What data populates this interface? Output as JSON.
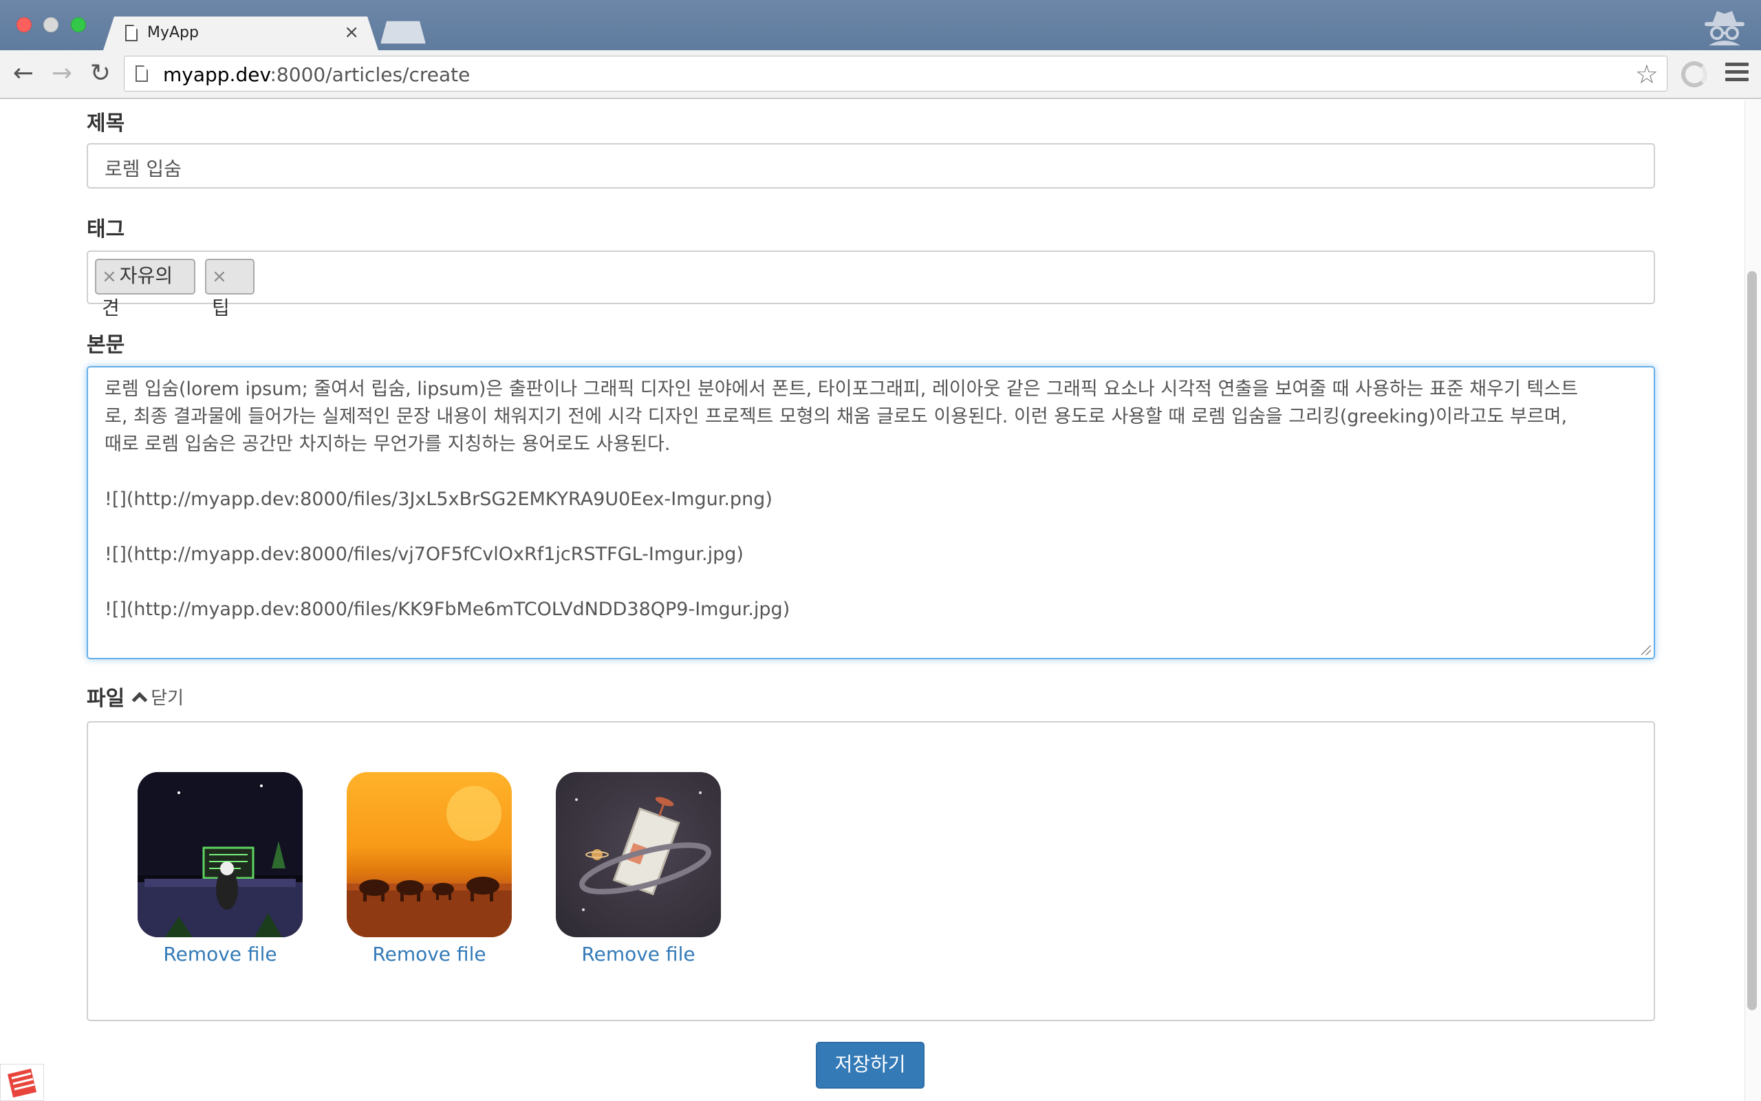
{
  "browser": {
    "tab_title": "MyApp",
    "tab_close": "×",
    "url_host": "myapp.dev",
    "url_rest": ":8000/articles/create",
    "back_glyph": "←",
    "forward_glyph": "→",
    "reload_glyph": "↻",
    "star_glyph": "☆"
  },
  "form": {
    "title_label": "제목",
    "title_value": "로렘 입숨",
    "tags_label": "태그",
    "tags": [
      {
        "remove": "×",
        "label": "자유의견"
      },
      {
        "remove": "×",
        "label": "팁"
      }
    ],
    "body_label": "본문",
    "body_lines": [
      "로렘 입숨(lorem ipsum; 줄여서 립숨, lipsum)은 출판이나 그래픽 디자인 분야에서 폰트, 타이포그래피, 레이아웃 같은 그래픽 요소나 시각적 연출을 보여줄 때 사용하는 표준 채우기 텍스트",
      "로, 최종 결과물에 들어가는 실제적인 문장 내용이 채워지기 전에 시각 디자인 프로젝트 모형의 채움 글로도 이용된다. 이런 용도로 사용할 때 로렘 입숨을 그리킹(greeking)이라고도 부르며,",
      "때로 로렘 입숨은 공간만 차지하는 무언가를 지칭하는 용어로도 사용된다.",
      "![](http://myapp.dev:8000/files/3JxL5xBrSG2EMKYRA9U0Eex-Imgur.png)",
      "![](http://myapp.dev:8000/files/vj7OF5fCvlOxRf1jcRSTFGL-Imgur.jpg)",
      "![](http://myapp.dev:8000/files/KK9FbMe6mTCOLVdNDD38QP9-Imgur.jpg)"
    ],
    "files_label": "파일",
    "files_toggle": "닫기",
    "files": [
      {
        "thumb": "night-office-illustration",
        "remove": "Remove file"
      },
      {
        "thumb": "sunset-elephants-illustration",
        "remove": "Remove file"
      },
      {
        "thumb": "space-station-illustration",
        "remove": "Remove file"
      }
    ],
    "save_label": "저장하기"
  },
  "colors": {
    "accent": "#337ab7",
    "focus_border": "#66afe9",
    "titlebar": "#6c87a8"
  }
}
